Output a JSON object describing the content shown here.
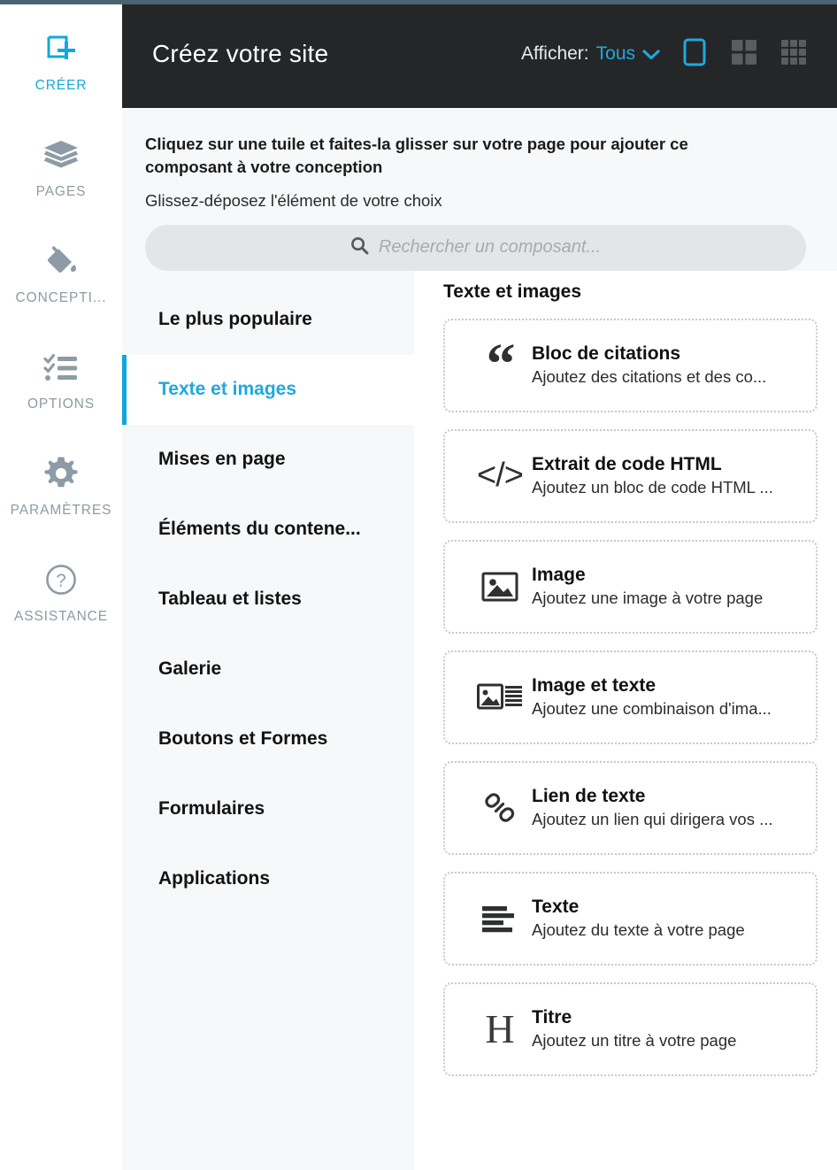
{
  "theme": {
    "accent": "#1fa8dd",
    "accent_bar": "#0fa6dc",
    "header_bg": "#252627",
    "top_strip": "#4c6374",
    "rail_label": "#8c9ba5",
    "panel_bg": "#f7f8f9",
    "tile_border": "#c6c8ca"
  },
  "rail": {
    "items": [
      {
        "label": "CRÉER",
        "icon": "add-square-icon",
        "active": true
      },
      {
        "label": "PAGES",
        "icon": "layers-icon",
        "active": false
      },
      {
        "label": "CONCEPTI...",
        "icon": "paint-bucket-icon",
        "active": false
      },
      {
        "label": "OPTIONS",
        "icon": "checklist-icon",
        "active": false
      },
      {
        "label": "PARAMÈTRES",
        "icon": "gear-icon",
        "active": false
      },
      {
        "label": "ASSISTANCE",
        "icon": "question-circle-icon",
        "active": false
      }
    ]
  },
  "header": {
    "title": "Créez votre site",
    "filter_label": "Afficher:",
    "filter_value": "Tous",
    "chevron_icon": "chevron-down-icon",
    "views": [
      {
        "icon": "view-single-icon",
        "active": true
      },
      {
        "icon": "view-grid-2x2-icon",
        "active": false
      },
      {
        "icon": "view-grid-3x3-icon",
        "active": false
      }
    ]
  },
  "band": {
    "instruction": "Cliquez sur une tuile et faites-la glisser sur votre page pour ajouter ce composant à votre conception",
    "subinstruction": "Glissez-déposez l'élément de votre choix",
    "search_icon": "search-icon",
    "search_placeholder": "Rechercher un composant...",
    "search_value": ""
  },
  "categories": [
    {
      "label": "Le plus populaire",
      "active": false
    },
    {
      "label": "Texte et images",
      "active": true
    },
    {
      "label": "Mises en page",
      "active": false
    },
    {
      "label": "Éléments du contene...",
      "active": false
    },
    {
      "label": "Tableau et listes",
      "active": false
    },
    {
      "label": "Galerie",
      "active": false
    },
    {
      "label": "Boutons et Formes",
      "active": false
    },
    {
      "label": "Formulaires",
      "active": false
    },
    {
      "label": "Applications",
      "active": false
    }
  ],
  "tiles_panel": {
    "title": "Texte et images",
    "tiles": [
      {
        "icon": "quote-block-icon",
        "title": "Bloc de citations",
        "desc": "Ajoutez des citations et des co..."
      },
      {
        "icon": "html-code-icon",
        "title": "Extrait de code HTML",
        "desc": "Ajoutez un bloc de code HTML ..."
      },
      {
        "icon": "image-icon",
        "title": "Image",
        "desc": "Ajoutez une image à votre page"
      },
      {
        "icon": "image-text-icon",
        "title": "Image et texte",
        "desc": "Ajoutez une combinaison d'ima..."
      },
      {
        "icon": "link-icon",
        "title": "Lien de texte",
        "desc": "Ajoutez un lien qui dirigera vos ..."
      },
      {
        "icon": "text-lines-icon",
        "title": "Texte",
        "desc": "Ajoutez du texte à votre page"
      },
      {
        "icon": "heading-h-icon",
        "title": "Titre",
        "desc": "Ajoutez un titre à votre page"
      }
    ]
  }
}
